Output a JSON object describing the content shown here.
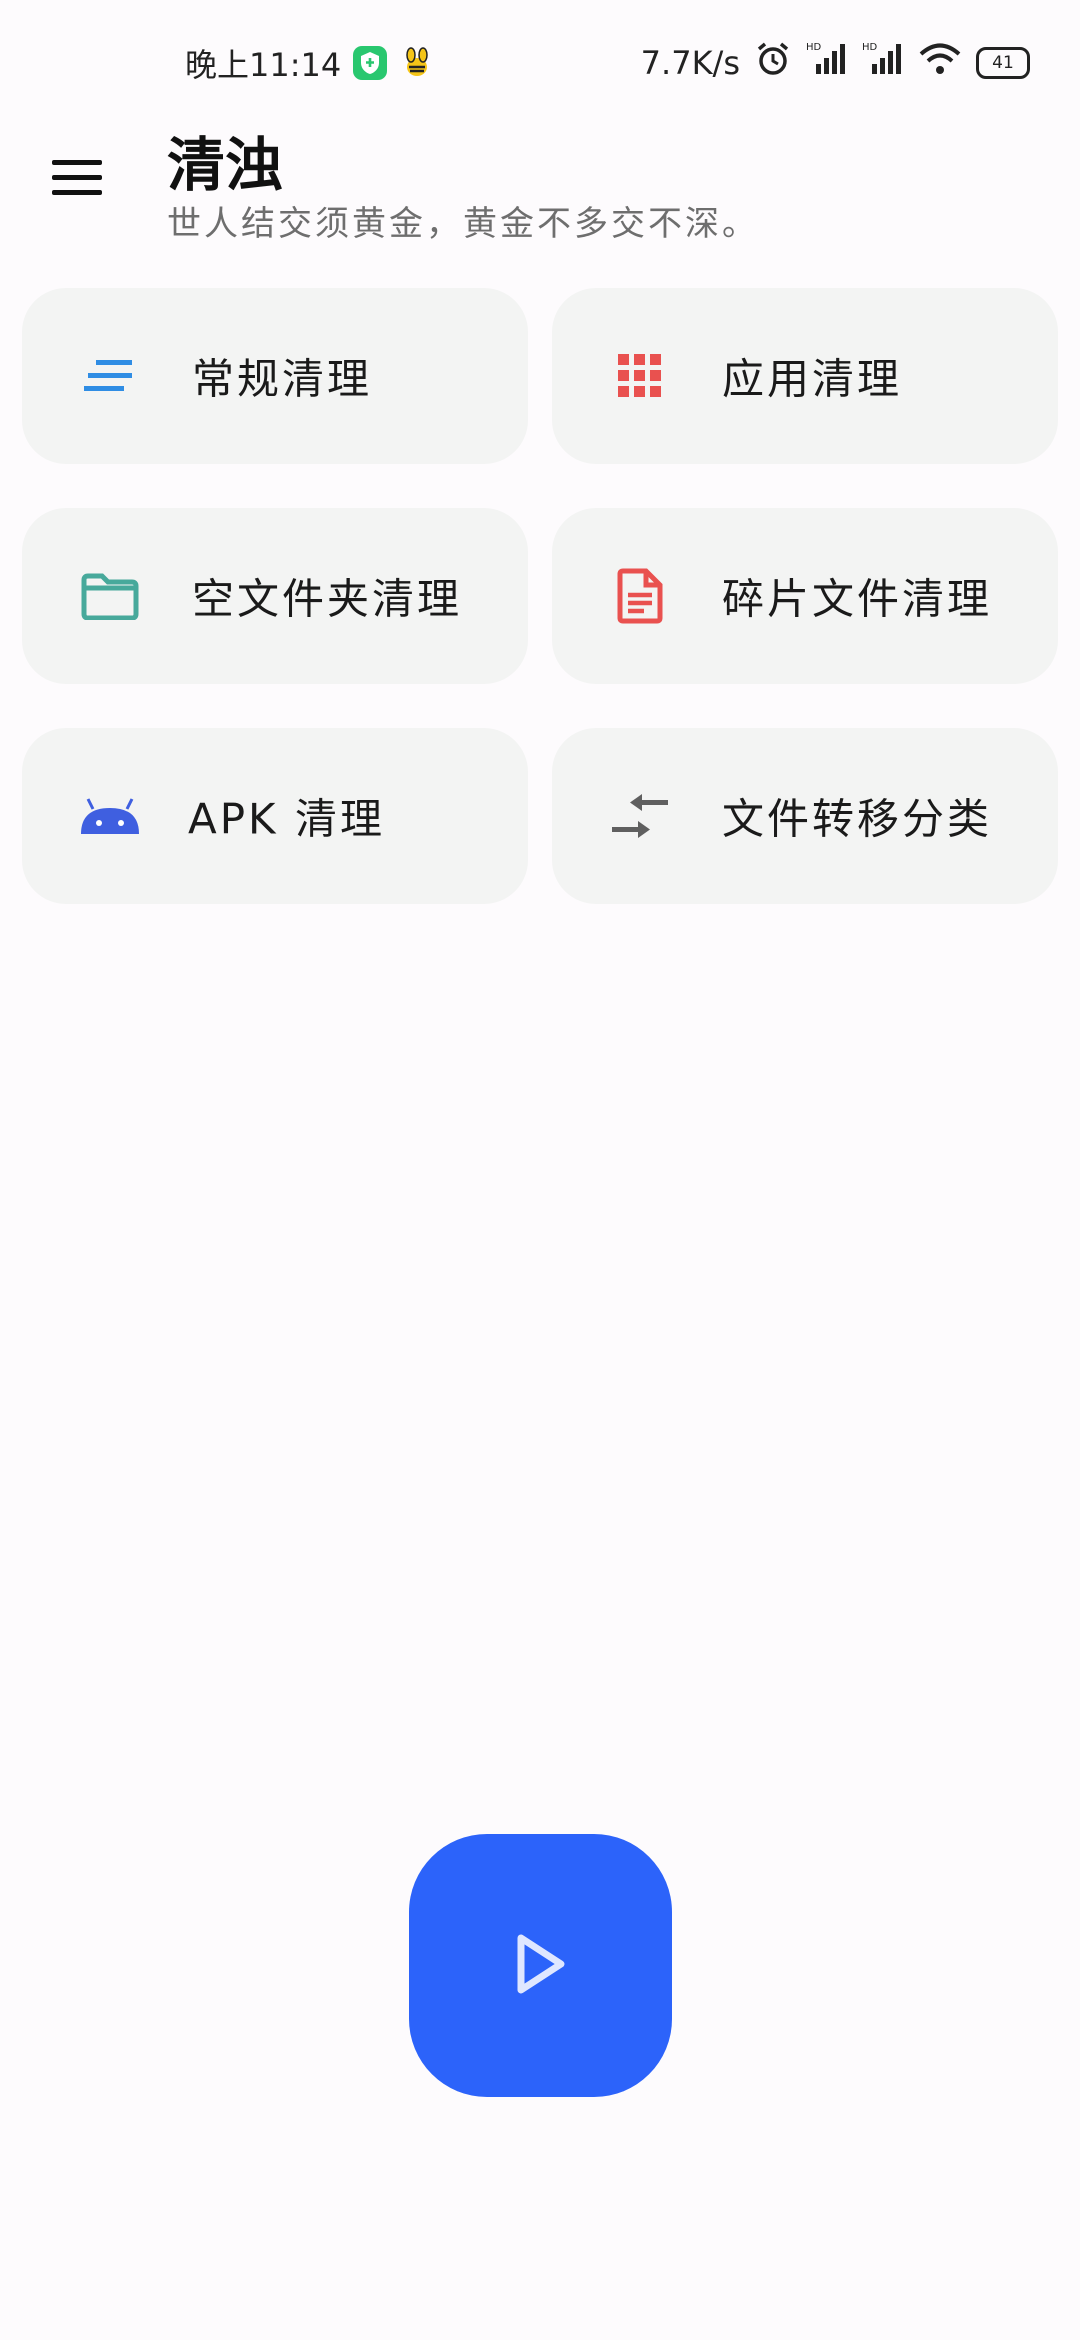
{
  "status_bar": {
    "time": "晚上11:14",
    "network_speed": "7.7K/s",
    "battery": "41",
    "icons": [
      "shield-badge-icon",
      "bee-icon",
      "alarm-icon",
      "signal-hd-icon",
      "signal-hd-icon",
      "wifi-icon",
      "battery-icon"
    ]
  },
  "header": {
    "title": "清浊",
    "subtitle": "世人结交须黄金，黄金不多交不深。",
    "menu_icon": "hamburger-menu-icon"
  },
  "cards": [
    {
      "label": "常规清理",
      "icon": "sort-lines-icon",
      "color": "#2f8de4"
    },
    {
      "label": "应用清理",
      "icon": "apps-grid-icon",
      "color": "#e9514f"
    },
    {
      "label": "空文件夹清理",
      "icon": "folder-icon",
      "color": "#47a99b"
    },
    {
      "label": "碎片文件清理",
      "icon": "document-icon",
      "color": "#e9514f"
    },
    {
      "label": "APK 清理",
      "icon": "android-icon",
      "color": "#3f5fe0"
    },
    {
      "label": "文件转移分类",
      "icon": "compare-arrows-icon",
      "color": "#5f5f5f"
    }
  ],
  "fab": {
    "icon": "play-icon",
    "color": "#2c63fa"
  }
}
